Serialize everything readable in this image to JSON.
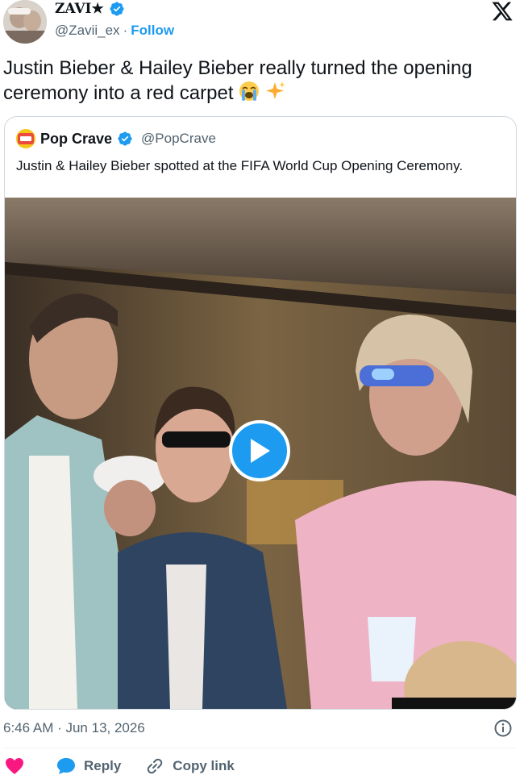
{
  "author": {
    "display_name": "ZAVI★",
    "handle": "@Zavii_ex",
    "separator": "·",
    "follow_label": "Follow"
  },
  "tweet": {
    "text": "Justin Bieber & Hailey Bieber really turned the opening ceremony into a red carpet",
    "emojis": [
      "loudly-crying-face-emoji",
      "sparkles-emoji"
    ]
  },
  "quoted": {
    "name": "Pop Crave",
    "handle": "@PopCrave",
    "text": "Justin & Hailey Bieber spotted at the FIFA World Cup Opening Ceremony."
  },
  "media": {
    "type": "video",
    "play_icon": "play-icon"
  },
  "timestamp": "6:46 AM · Jun 13, 2026",
  "actions": {
    "like_icon": "heart-icon",
    "reply_label": "Reply",
    "copy_label": "Copy link"
  },
  "colors": {
    "accent": "#1d9bf0",
    "like": "#f91880",
    "secondary_text": "#536471",
    "border": "#cfd9de"
  }
}
